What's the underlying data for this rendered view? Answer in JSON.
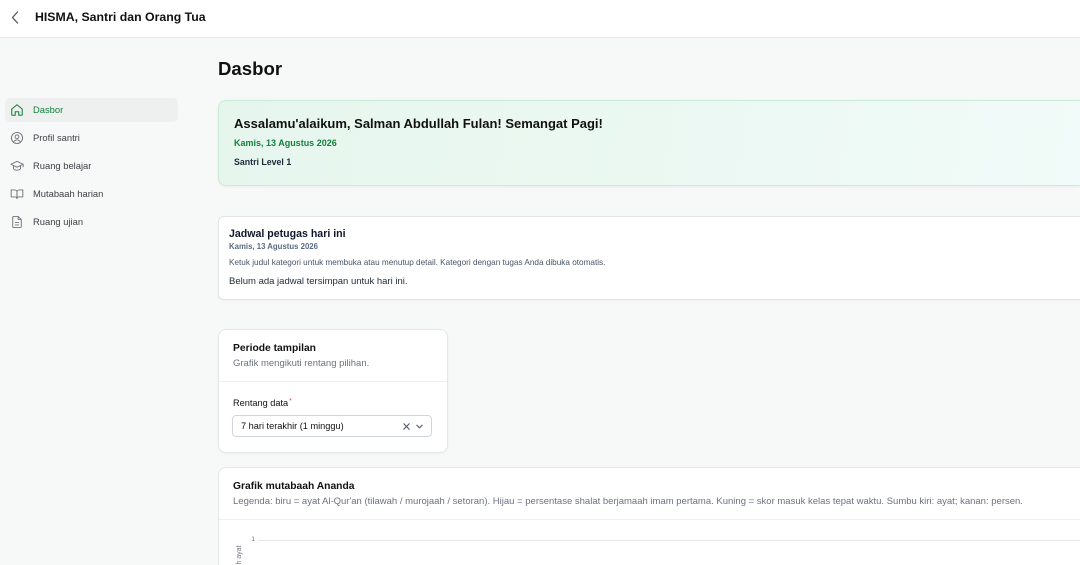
{
  "app": {
    "title": "HISMA, Santri dan Orang Tua",
    "back_icon": "chevron-left-icon"
  },
  "sidebar": {
    "items": [
      {
        "label": "Dasbor",
        "icon": "home-icon",
        "active": true
      },
      {
        "label": "Profil santri",
        "icon": "user-circle-icon",
        "active": false
      },
      {
        "label": "Ruang belajar",
        "icon": "graduation-cap-icon",
        "active": false
      },
      {
        "label": "Mutabaah harian",
        "icon": "book-open-icon",
        "active": false
      },
      {
        "label": "Ruang ujian",
        "icon": "file-text-icon",
        "active": false
      }
    ]
  },
  "main": {
    "page_title": "Dasbor",
    "welcome": {
      "greeting": "Assalamu'alaikum, Salman Abdullah Fulan! Semangat Pagi!",
      "date": "Kamis, 13 Agustus 2026",
      "level": "Santri Level 1"
    },
    "schedule": {
      "title": "Jadwal petugas hari ini",
      "date": "Kamis, 13 Agustus 2026",
      "hint": "Ketuk judul kategori untuk membuka atau menutup detail. Kategori dengan tugas Anda dibuka otomatis.",
      "empty": "Belum ada jadwal tersimpan untuk hari ini."
    },
    "period": {
      "title": "Periode tampilan",
      "subtitle": "Grafik mengikuti rentang pilihan.",
      "field_label": "Rentang data",
      "required_mark": "*",
      "selected": "7 hari terakhir (1 minggu)",
      "clear_icon": "close-icon",
      "dropdown_icon": "chevron-down-icon"
    },
    "chart_card": {
      "title": "Grafik mutabaah Ananda",
      "legend": "Legenda: biru = ayat Al-Qur'an (tilawah / murojaah / setoran). Hijau = persentase shalat berjamaah imam pertama. Kuning = skor masuk kelas tepat waktu. Sumbu kiri: ayat; kanan: persen.",
      "y_tick": "1",
      "y_label": "h ayat"
    }
  },
  "colors": {
    "accent": "#15803d",
    "required": "#ef4444",
    "welcome_gradient_start": "#e6f6ed",
    "welcome_gradient_end": "#f1fbf9",
    "page_background": "#f7f8f8"
  }
}
